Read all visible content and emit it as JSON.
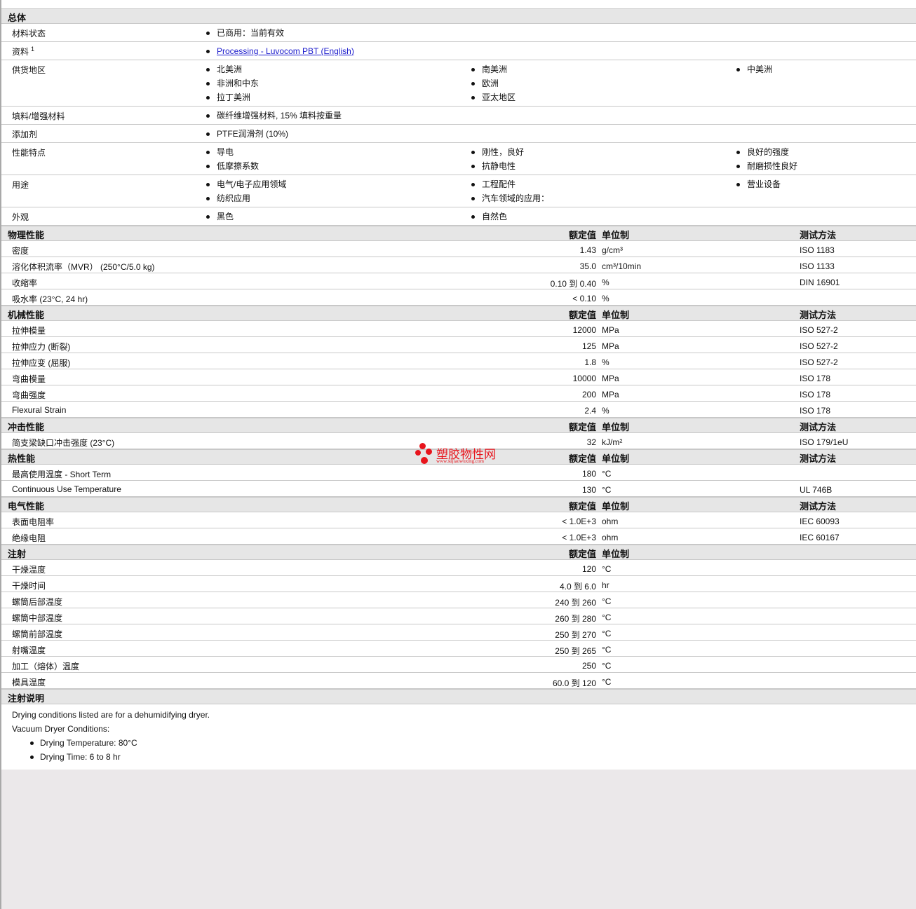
{
  "general": {
    "title": "总体",
    "rows": [
      {
        "label": "材料状态",
        "items": [
          "已商用：当前有效"
        ]
      },
      {
        "label": "资料",
        "sup": "1",
        "items": [
          "Processing - Luvocom PBT (English)"
        ],
        "link": true
      },
      {
        "label": "供货地区",
        "items": [
          "北美洲",
          "南美洲",
          "中美洲",
          "非洲和中东",
          "欧洲",
          "",
          "拉丁美洲",
          "亚太地区",
          ""
        ]
      },
      {
        "label": "填料/增强材料",
        "items": [
          "碳纤维增强材料, 15% 填料按重量"
        ]
      },
      {
        "label": "添加剂",
        "items": [
          "PTFE润滑剂 (10%)"
        ]
      },
      {
        "label": "性能特点",
        "items": [
          "导电",
          "刚性，良好",
          "良好的强度",
          "低摩擦系数",
          "抗静电性",
          "耐磨损性良好"
        ]
      },
      {
        "label": "用途",
        "items": [
          "电气/电子应用领域",
          "工程配件",
          "营业设备",
          "纺织应用",
          "汽车领域的应用：",
          ""
        ]
      },
      {
        "label": "外观",
        "items": [
          "黑色",
          "自然色"
        ]
      }
    ]
  },
  "headers": {
    "value": "额定值",
    "unit": "单位制",
    "method": "测试方法"
  },
  "sections": [
    {
      "title": "物理性能",
      "method": true,
      "rows": [
        {
          "label": "密度",
          "value": "1.43",
          "unit": "g/cm³",
          "method": "ISO 1183"
        },
        {
          "label": "溶化体积流率（MVR） (250°C/5.0 kg)",
          "value": "35.0",
          "unit": "cm³/10min",
          "method": "ISO 1133"
        },
        {
          "label": "收缩率",
          "value": "0.10 到  0.40",
          "unit": "%",
          "method": "DIN 16901"
        },
        {
          "label": "吸水率 (23°C, 24 hr)",
          "value": "< 0.10",
          "unit": "%",
          "method": ""
        }
      ]
    },
    {
      "title": "机械性能",
      "method": true,
      "rows": [
        {
          "label": "拉伸模量",
          "value": "12000",
          "unit": "MPa",
          "method": "ISO 527-2"
        },
        {
          "label": "拉伸应力 (断裂)",
          "value": "125",
          "unit": "MPa",
          "method": "ISO 527-2"
        },
        {
          "label": "拉伸应变 (屈服)",
          "value": "1.8",
          "unit": "%",
          "method": "ISO 527-2"
        },
        {
          "label": "弯曲模量",
          "value": "10000",
          "unit": "MPa",
          "method": "ISO 178"
        },
        {
          "label": "弯曲强度",
          "value": "200",
          "unit": "MPa",
          "method": "ISO 178"
        },
        {
          "label": "Flexural Strain",
          "value": "2.4",
          "unit": "%",
          "method": "ISO 178"
        }
      ]
    },
    {
      "title": "冲击性能",
      "method": true,
      "rows": [
        {
          "label": "简支梁缺口冲击强度 (23°C)",
          "value": "32",
          "unit": "kJ/m²",
          "method": "ISO 179/1eU"
        }
      ]
    },
    {
      "title": "热性能",
      "method": true,
      "rows": [
        {
          "label": "最高使用温度 - Short Term",
          "value": "180",
          "unit": "°C",
          "method": ""
        },
        {
          "label": "Continuous Use Temperature",
          "value": "130",
          "unit": "°C",
          "method": "UL 746B"
        }
      ]
    },
    {
      "title": "电气性能",
      "method": true,
      "rows": [
        {
          "label": "表面电阻率",
          "value": "< 1.0E+3",
          "unit": "ohm",
          "method": "IEC 60093"
        },
        {
          "label": "绝缘电阻",
          "value": "< 1.0E+3",
          "unit": "ohm",
          "method": "IEC 60167"
        }
      ]
    },
    {
      "title": "注射",
      "method": false,
      "rows": [
        {
          "label": "干燥温度",
          "value": "120",
          "unit": "°C",
          "method": ""
        },
        {
          "label": "干燥时间",
          "value": "4.0 到  6.0",
          "unit": "hr",
          "method": ""
        },
        {
          "label": "螺筒后部温度",
          "value": "240 到  260",
          "unit": "°C",
          "method": ""
        },
        {
          "label": "螺筒中部温度",
          "value": "260 到  280",
          "unit": "°C",
          "method": ""
        },
        {
          "label": "螺筒前部温度",
          "value": "250 到  270",
          "unit": "°C",
          "method": ""
        },
        {
          "label": "射嘴温度",
          "value": "250 到  265",
          "unit": "°C",
          "method": ""
        },
        {
          "label": "加工（熔体）温度",
          "value": "250",
          "unit": "°C",
          "method": ""
        },
        {
          "label": "模具温度",
          "value": "60.0 到  120",
          "unit": "°C",
          "method": ""
        }
      ]
    }
  ],
  "notes": {
    "title": "注射说明",
    "lines": [
      "Drying conditions listed are for a dehumidifying dryer.",
      "Vacuum Dryer Conditions:"
    ],
    "bullets": [
      "Drying Temperature: 80°C",
      "Drying Time: 6 to 8 hr"
    ]
  },
  "watermark": {
    "name": "塑胶物性网",
    "url": "www.sujiaowuxing.com",
    "color": "#e8141c"
  }
}
